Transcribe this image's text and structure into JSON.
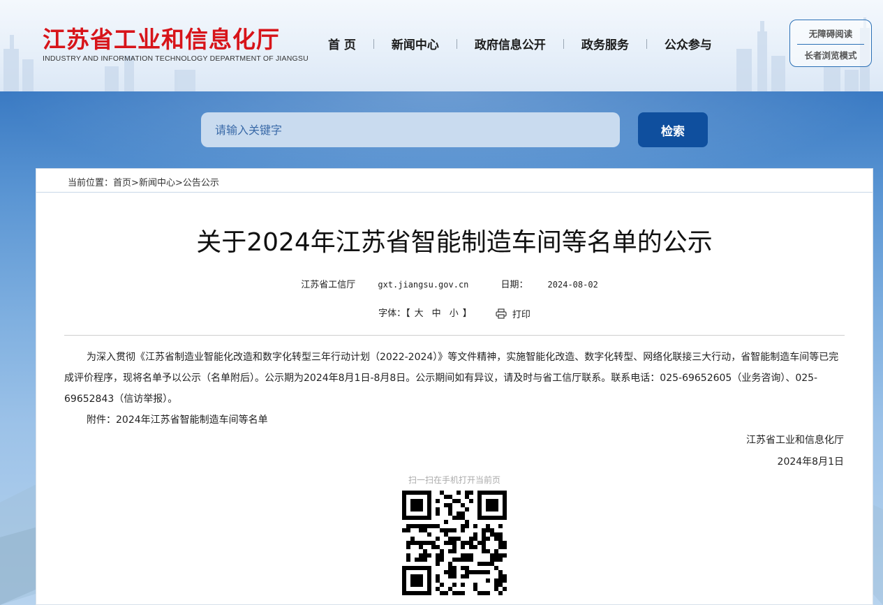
{
  "header": {
    "logo_cn": "江苏省工业和信息化厅",
    "logo_en": "INDUSTRY AND INFORMATION TECHNOLOGY DEPARTMENT OF JIANGSU",
    "nav": [
      "首 页",
      "新闻中心",
      "政府信息公开",
      "政务服务",
      "公众参与"
    ],
    "accessibility": "无障碍阅读",
    "elder_mode": "长者浏览模式"
  },
  "search": {
    "placeholder": "请输入关键字",
    "button": "检索"
  },
  "breadcrumb": {
    "prefix": "当前位置：",
    "items": [
      "首页",
      "新闻中心",
      "公告公示"
    ],
    "sep": ">"
  },
  "article": {
    "title": "关于2024年江苏省智能制造车间等名单的公示",
    "source": "江苏省工信厅",
    "site": "gxt.jiangsu.gov.cn",
    "date_label": "日期：",
    "date": "2024-08-02",
    "font_label": "字体：",
    "bracket_open": "【",
    "bracket_close": "】",
    "font_large": "大",
    "font_medium": "中",
    "font_small": "小",
    "print": "打印",
    "paragraph1": "为深入贯彻《江苏省制造业智能化改造和数字化转型三年行动计划（2022-2024）》等文件精神，实施智能化改造、数字化转型、网络化联接三大行动，省智能制造车间等已完成评价程序，现将名单予以公示（名单附后）。公示期为2024年8月1日-8月8日。公示期间如有异议，请及时与省工信厅联系。联系电话：025-69652605（业务咨询）、025-69652843（信访举报）。",
    "paragraph2": "附件：2024年江苏省智能制造车间等名单",
    "signature": "江苏省工业和信息化厅",
    "sign_date": "2024年8月1日"
  },
  "qr": {
    "label": "扫一扫在手机打开当前页"
  },
  "colors": {
    "logo_red": "#d7141a",
    "search_button": "#0f4f9e",
    "banner_blue": "#3f7fc6"
  }
}
